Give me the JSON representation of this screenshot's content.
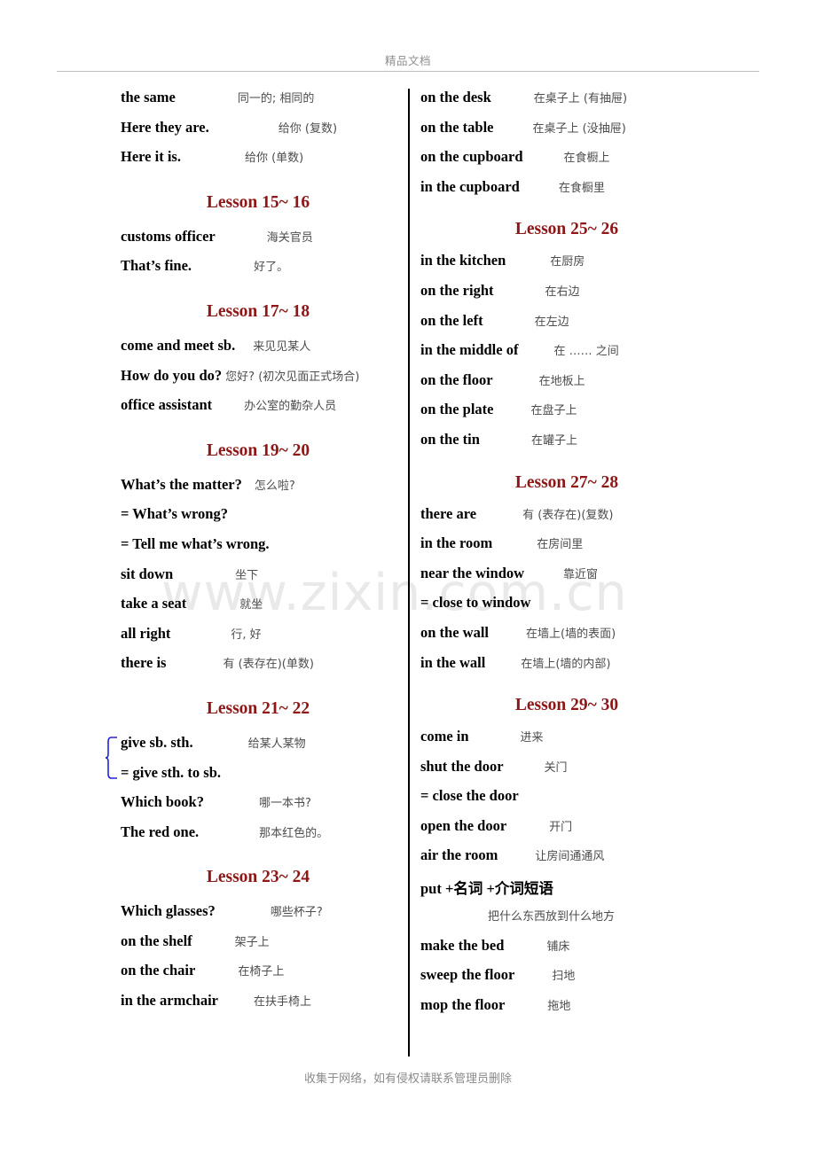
{
  "header": {
    "title": "精品文档"
  },
  "footer": {
    "note": "收集于网络，如有侵权请联系管理员删除"
  },
  "watermark": {
    "text": "www.zixin.com.cn"
  },
  "colors": {
    "lesson_heading": "#8e1616",
    "english_text": "#000000",
    "chinese_text": "#4d4d4d",
    "brace": "#2222dd",
    "divider": "#000000",
    "header_footer_text": "#8a8a8a",
    "watermark": "#e9e9e9"
  },
  "left_column": [
    {
      "type": "entry",
      "en": "the same",
      "cn": "同一的; 相同的",
      "gap": 70
    },
    {
      "type": "entry",
      "en": "Here they are.",
      "cn": "给你 (复数)",
      "gap": 78
    },
    {
      "type": "entry",
      "en": "Here it is.",
      "cn": "给你 (单数)",
      "gap": 72
    },
    {
      "type": "lesson",
      "label": "Lesson 15~ 16"
    },
    {
      "type": "entry",
      "en": "customs officer",
      "cn": "海关官员",
      "gap": 58
    },
    {
      "type": "entry",
      "en": "That’s fine.",
      "cn": "好了。",
      "gap": 70
    },
    {
      "type": "lesson",
      "label": "Lesson 17~ 18"
    },
    {
      "type": "entry",
      "en": "come and meet sb.",
      "cn": "来见见某人",
      "gap": 20
    },
    {
      "type": "entry",
      "en": "How do you do?",
      "cn": "您好? (初次见面正式场合)",
      "gap": 4
    },
    {
      "type": "entry",
      "en": "office assistant",
      "cn": "办公室的勤杂人员",
      "gap": 36
    },
    {
      "type": "lesson",
      "label": "Lesson 19~ 20"
    },
    {
      "type": "entry",
      "en": "What’s the matter?",
      "cn": "怎么啦?",
      "gap": 14
    },
    {
      "type": "entry",
      "en": "= What’s wrong?",
      "cn": "",
      "gap": 0
    },
    {
      "type": "entry",
      "en": "= Tell me what’s wrong.",
      "cn": "",
      "gap": 0
    },
    {
      "type": "entry",
      "en": "sit down",
      "cn": "坐下",
      "gap": 70
    },
    {
      "type": "entry",
      "en": "take a seat",
      "cn": "就坐",
      "gap": 60
    },
    {
      "type": "entry",
      "en": "all right",
      "cn": "行, 好",
      "gap": 68
    },
    {
      "type": "entry",
      "en": "there is",
      "cn": "有 (表存在)(单数)",
      "gap": 64
    },
    {
      "type": "lesson",
      "label": "Lesson 21~ 22"
    },
    {
      "type": "entry",
      "en": "give sb. sth.",
      "cn": "给某人某物",
      "gap": 62,
      "brace_start": true
    },
    {
      "type": "entry",
      "en": "= give sth. to sb.",
      "cn": "",
      "gap": 0
    },
    {
      "type": "entry",
      "en": "Which book?",
      "cn": "哪一本书?",
      "gap": 62
    },
    {
      "type": "entry",
      "en": "The red one.",
      "cn": "那本红色的。",
      "gap": 68
    },
    {
      "type": "lesson",
      "label": "Lesson 23~ 24"
    },
    {
      "type": "entry",
      "en": "Which glasses?",
      "cn": "哪些杯子?",
      "gap": 62
    },
    {
      "type": "entry",
      "en": "on the shelf",
      "cn": "架子上",
      "gap": 48
    },
    {
      "type": "entry",
      "en": "on the chair",
      "cn": "在椅子上",
      "gap": 48
    },
    {
      "type": "entry",
      "en": "in the armchair",
      "cn": "在扶手椅上",
      "gap": 40
    }
  ],
  "right_column": [
    {
      "type": "entry",
      "en": "on the desk",
      "cn": "在桌子上 (有抽屉)",
      "gap": 48
    },
    {
      "type": "entry",
      "en": "on the table",
      "cn": "在桌子上 (没抽屉)",
      "gap": 44
    },
    {
      "type": "entry",
      "en": "on the cupboard",
      "cn": "在食橱上",
      "gap": 46
    },
    {
      "type": "entry",
      "en": "in the cupboard",
      "cn": "在食橱里",
      "gap": 44
    },
    {
      "type": "lesson",
      "label": "Lesson 25~ 26"
    },
    {
      "type": "entry",
      "en": "in the kitchen",
      "cn": "在厨房",
      "gap": 50
    },
    {
      "type": "entry",
      "en": "on the right",
      "cn": "在右边",
      "gap": 58
    },
    {
      "type": "entry",
      "en": "on the left",
      "cn": "在左边",
      "gap": 58
    },
    {
      "type": "entry",
      "en": "in the middle of",
      "cn": "在 …… 之间",
      "gap": 40
    },
    {
      "type": "entry",
      "en": "on the floor",
      "cn": "在地板上",
      "gap": 52
    },
    {
      "type": "entry",
      "en": "on the plate",
      "cn": "在盘子上",
      "gap": 42
    },
    {
      "type": "entry",
      "en": "on the tin",
      "cn": "在罐子上",
      "gap": 58
    },
    {
      "type": "lesson",
      "label": "Lesson 27~ 28"
    },
    {
      "type": "entry",
      "en": "there are",
      "cn": "有 (表存在)(复数)",
      "gap": 52
    },
    {
      "type": "entry",
      "en": "in the room",
      "cn": "在房间里",
      "gap": 50
    },
    {
      "type": "entry",
      "en": "near the window",
      "cn": "靠近窗",
      "gap": 44
    },
    {
      "type": "entry",
      "en": "= close to window",
      "cn": "",
      "gap": 0
    },
    {
      "type": "entry",
      "en": "on the wall",
      "cn": "在墙上(墙的表面)",
      "gap": 42
    },
    {
      "type": "entry",
      "en": "in the wall",
      "cn": "在墙上(墙的内部)",
      "gap": 40
    },
    {
      "type": "lesson",
      "label": "Lesson 29~ 30"
    },
    {
      "type": "entry",
      "en": "come in",
      "cn": "进来",
      "gap": 58
    },
    {
      "type": "entry",
      "en": "shut the door",
      "cn": "关门",
      "gap": 46
    },
    {
      "type": "entry",
      "en": "= close the door",
      "cn": "",
      "gap": 0
    },
    {
      "type": "entry",
      "en": "open the door",
      "cn": "开门",
      "gap": 48
    },
    {
      "type": "entry",
      "en": "air the room",
      "cn": "让房间通通风",
      "gap": 42
    },
    {
      "type": "entry",
      "en": "put +名词 +介词短语",
      "cn": "",
      "gap": 0
    },
    {
      "type": "contline",
      "en": "",
      "cn": "把什么东西放到什么地方"
    },
    {
      "type": "entry",
      "en": "make the bed",
      "cn": "铺床",
      "gap": 48
    },
    {
      "type": "entry",
      "en": "sweep the floor",
      "cn": "扫地",
      "gap": 42
    },
    {
      "type": "entry",
      "en": "mop the floor",
      "cn": "拖地",
      "gap": 48
    }
  ]
}
